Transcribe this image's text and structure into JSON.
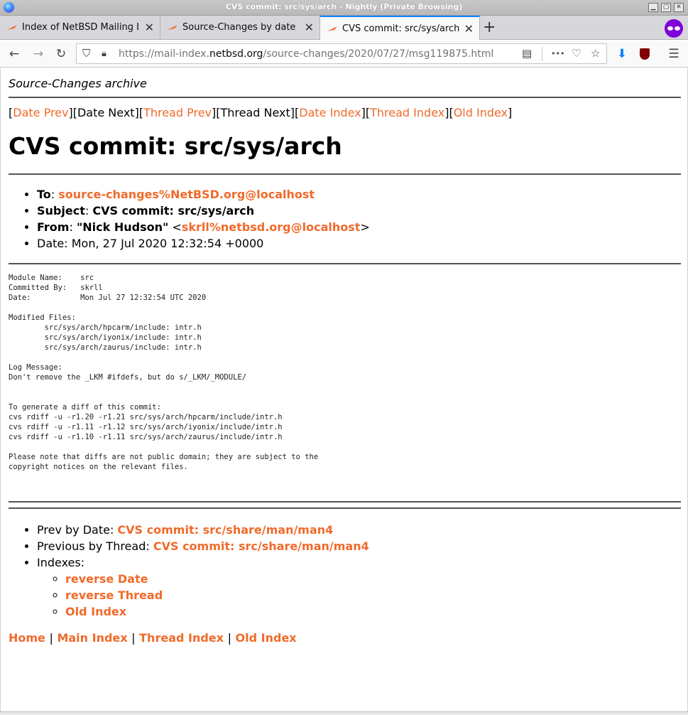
{
  "window": {
    "title": "CVS commit: src/sys/arch - Nightly (Private Browsing)"
  },
  "tabs": [
    {
      "label": "Index of NetBSD Mailing Lis",
      "active": false
    },
    {
      "label": "Source-Changes by date",
      "active": false
    },
    {
      "label": "CVS commit: src/sys/arch",
      "active": true
    }
  ],
  "toolbar": {
    "url_prefix": "https://mail-index.",
    "url_host": "netbsd.org",
    "url_path": "/source-changes/2020/07/27/msg119875.html",
    "ellipsis": "•••",
    "colors": {
      "accent": "#0a84ff",
      "private": "#8000d7",
      "link": "#f06a2a"
    }
  },
  "page": {
    "archive_title": "Source-Changes archive",
    "nav": {
      "date_prev": "Date Prev",
      "date_next": "Date Next",
      "thread_prev": "Thread Prev",
      "thread_next": "Thread Next",
      "date_index": "Date Index",
      "thread_index": "Thread Index",
      "old_index": "Old Index"
    },
    "title": "CVS commit: src/sys/arch",
    "headers": {
      "to_label": "To",
      "to_value": "source-changes%NetBSD.org@localhost",
      "subject_label": "Subject",
      "subject_value": "CVS commit: src/sys/arch",
      "from_label": "From",
      "from_name": "\"Nick Hudson\"",
      "from_email": "skrll%netbsd.org@localhost",
      "date_label": "Date",
      "date_value": "Mon, 27 Jul 2020 12:32:54 +0000"
    },
    "body": "Module Name:    src\nCommitted By:   skrll\nDate:           Mon Jul 27 12:32:54 UTC 2020\n\nModified Files:\n        src/sys/arch/hpcarm/include: intr.h\n        src/sys/arch/iyonix/include: intr.h\n        src/sys/arch/zaurus/include: intr.h\n\nLog Message:\nDon't remove the _LKM #ifdefs, but do s/_LKM/_MODULE/\n\n\nTo generate a diff of this commit:\ncvs rdiff -u -r1.20 -r1.21 src/sys/arch/hpcarm/include/intr.h\ncvs rdiff -u -r1.11 -r1.12 src/sys/arch/iyonix/include/intr.h\ncvs rdiff -u -r1.10 -r1.11 src/sys/arch/zaurus/include/intr.h\n\nPlease note that diffs are not public domain; they are subject to the\ncopyright notices on the relevant files.",
    "footer_list": {
      "prev_by_date_label": "Prev by Date: ",
      "prev_by_date_link": "CVS commit: src/share/man/man4",
      "prev_by_thread_label": "Previous by Thread: ",
      "prev_by_thread_link": "CVS commit: src/share/man/man4",
      "indexes_label": "Indexes:",
      "reverse_date": "reverse Date",
      "reverse_thread": "reverse Thread",
      "old_index": "Old Index"
    },
    "bottom_nav": {
      "home": "Home",
      "main_index": "Main Index",
      "thread_index": "Thread Index",
      "old_index": "Old Index"
    }
  }
}
